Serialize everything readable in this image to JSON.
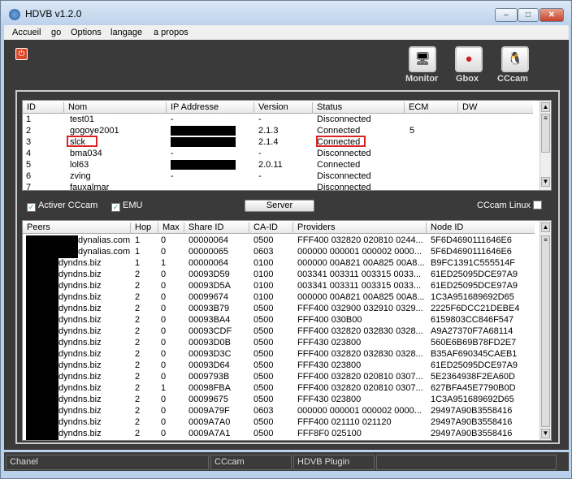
{
  "window": {
    "title": "HDVB v1.2.0",
    "min": "‒",
    "max": "□",
    "close": "✕"
  },
  "menu": [
    "Accueil",
    "go",
    "Options",
    "langage",
    "a propos"
  ],
  "toolbar": [
    {
      "label": "Monitor",
      "icon": "monitor-icon",
      "glyph": "🖥"
    },
    {
      "label": "Gbox",
      "icon": "gbox-icon",
      "glyph": "●"
    },
    {
      "label": "CCcam",
      "icon": "linux-icon",
      "glyph": "🐧"
    }
  ],
  "clients": {
    "columns": [
      "ID",
      "Nom",
      "IP Addresse",
      "Version",
      "Status",
      "ECM",
      "DW"
    ],
    "rows": [
      {
        "id": "1",
        "nom": "test01",
        "ip": "-",
        "ver": "-",
        "status": "Disconnected",
        "ecm": ""
      },
      {
        "id": "2",
        "nom": "gogoye2001",
        "ip": "",
        "ver": "2.1.3",
        "status": "Connected",
        "ecm": "5"
      },
      {
        "id": "3",
        "nom": "slck",
        "ip": "",
        "ver": "2.1.4",
        "status": "Connected",
        "ecm": ""
      },
      {
        "id": "4",
        "nom": "bma034",
        "ip": "-",
        "ver": "-",
        "status": "Disconnected",
        "ecm": ""
      },
      {
        "id": "5",
        "nom": "lol63",
        "ip": "",
        "ver": "2.0.11",
        "status": "Connected",
        "ecm": ""
      },
      {
        "id": "6",
        "nom": "zving",
        "ip": "-",
        "ver": "-",
        "status": "Disconnected",
        "ecm": ""
      },
      {
        "id": "7",
        "nom": "fauxalmar",
        "ip": "",
        "ver": "",
        "status": "Disconnected",
        "ecm": ""
      }
    ]
  },
  "controls": {
    "cccam": "Activer CCcam",
    "emu": "EMU",
    "server": "Server",
    "linux": "CCcam Linux"
  },
  "peers": {
    "columns": [
      "Peers",
      "Hop",
      "Max",
      "Share ID",
      "CA-ID",
      "Providers",
      "Node ID"
    ],
    "rows": [
      [
        "dynalias.com",
        "1",
        "0",
        "00000064",
        "0500",
        "FFF400 032820 020810 0244...",
        "5F6D4690111646E6"
      ],
      [
        "dynalias.com",
        "1",
        "0",
        "00000065",
        "0603",
        "000000 000001 000002 0000...",
        "5F6D4690111646E6"
      ],
      [
        "dyndns.biz",
        "1",
        "1",
        "00000064",
        "0100",
        "000000 00A821 00A825 00A8...",
        "B9FC1391C555514F"
      ],
      [
        "dyndns.biz",
        "2",
        "0",
        "00093D59",
        "0100",
        "003341 003311 003315 0033...",
        "61ED25095DCE97A9"
      ],
      [
        "dyndns.biz",
        "2",
        "0",
        "00093D5A",
        "0100",
        "003341 003311 003315 0033...",
        "61ED25095DCE97A9"
      ],
      [
        "dyndns.biz",
        "2",
        "0",
        "00099674",
        "0100",
        "000000 00A821 00A825 00A8...",
        "1C3A951689692D65"
      ],
      [
        "dyndns.biz",
        "2",
        "0",
        "00093B79",
        "0500",
        "FFF400 032900 032910 0329...",
        "2225F6DCC21DEBE4"
      ],
      [
        "dyndns.biz",
        "2",
        "0",
        "00093BA4",
        "0500",
        "FFF400 030B00",
        "6159803CC846F547"
      ],
      [
        "dyndns.biz",
        "2",
        "0",
        "00093CDF",
        "0500",
        "FFF400 032820 032830 0328...",
        "A9A27370F7A68114"
      ],
      [
        "dyndns.biz",
        "2",
        "0",
        "00093D0B",
        "0500",
        "FFF430 023800",
        "560E6B69B78FD2E7"
      ],
      [
        "dyndns.biz",
        "2",
        "0",
        "00093D3C",
        "0500",
        "FFF400 032820 032830 0328...",
        "B35AF690345CAEB1"
      ],
      [
        "dyndns.biz",
        "2",
        "0",
        "00093D64",
        "0500",
        "FFF430 023800",
        "61ED25095DCE97A9"
      ],
      [
        "dyndns.biz",
        "2",
        "0",
        "0009793B",
        "0500",
        "FFF400 032820 020810 0307...",
        "5E2364938F2EA60D"
      ],
      [
        "dyndns.biz",
        "2",
        "1",
        "00098FBA",
        "0500",
        "FFF400 032820 020810 0307...",
        "627BFA45E7790B0D"
      ],
      [
        "dyndns.biz",
        "2",
        "0",
        "00099675",
        "0500",
        "FFF430 023800",
        "1C3A951689692D65"
      ],
      [
        "dyndns.biz",
        "2",
        "0",
        "0009A79F",
        "0603",
        "000000 000001 000002 0000...",
        "29497A90B3558416"
      ],
      [
        "dyndns.biz",
        "2",
        "0",
        "0009A7A0",
        "0500",
        "FFF400 021110 021120",
        "29497A90B3558416"
      ],
      [
        "dyndns.biz",
        "2",
        "0",
        "0009A7A1",
        "0500",
        "FFF8F0 025100",
        "29497A90B3558416"
      ]
    ]
  },
  "statusbar": [
    "Chanel",
    "CCcam",
    "HDVB Plugin",
    ""
  ]
}
